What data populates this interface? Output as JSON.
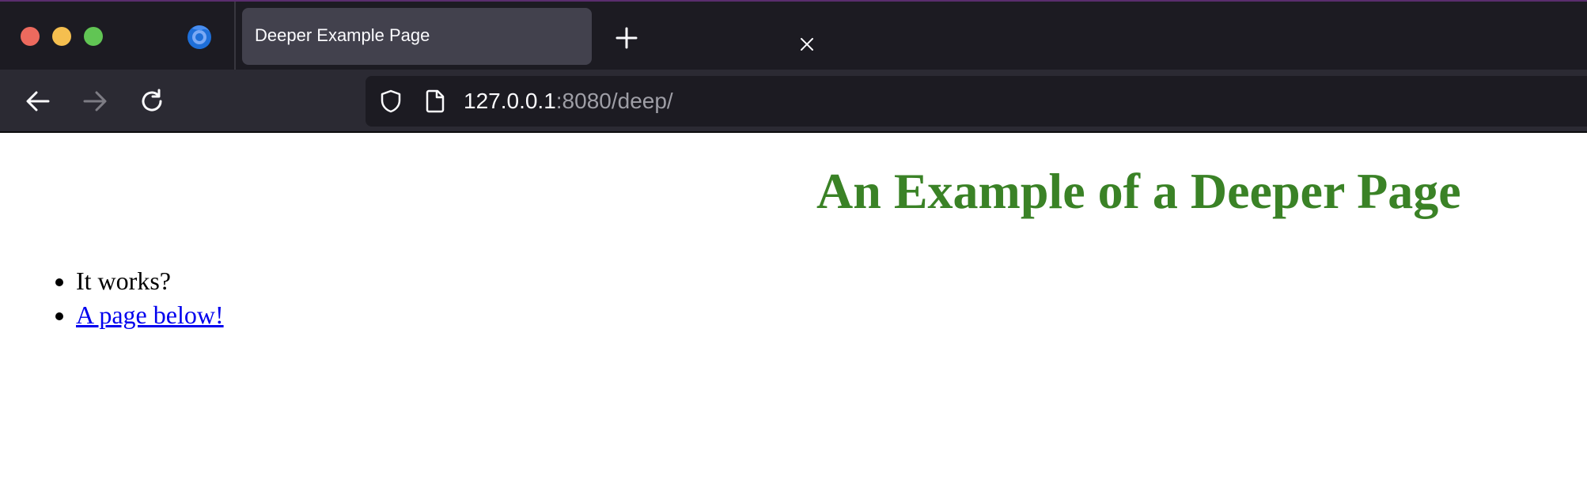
{
  "window": {
    "controls": [
      "close",
      "minimize",
      "zoom"
    ],
    "browser_icon": "firefox-logo-icon"
  },
  "tabs": [
    {
      "title": "Deeper Example Page",
      "active": true
    }
  ],
  "toolbar": {
    "back_icon": "back-arrow-icon",
    "forward_icon": "forward-arrow-icon",
    "reload_icon": "reload-icon",
    "new_tab_icon": "plus-icon"
  },
  "urlbar": {
    "host": "127.0.0.1",
    "rest": ":8080/deep/",
    "security_icon": "shield-icon",
    "page_icon": "page-icon"
  },
  "page": {
    "heading": "An Example of a Deeper Page",
    "heading_color": "#3a8226",
    "items": [
      {
        "text": "It works?",
        "is_link": false
      },
      {
        "text": "A page below!",
        "is_link": true
      }
    ]
  },
  "colors": {
    "chrome_dark": "#1c1b22",
    "toolbar": "#2b2a33",
    "active_tab": "#42414d",
    "link": "#0000ee"
  }
}
